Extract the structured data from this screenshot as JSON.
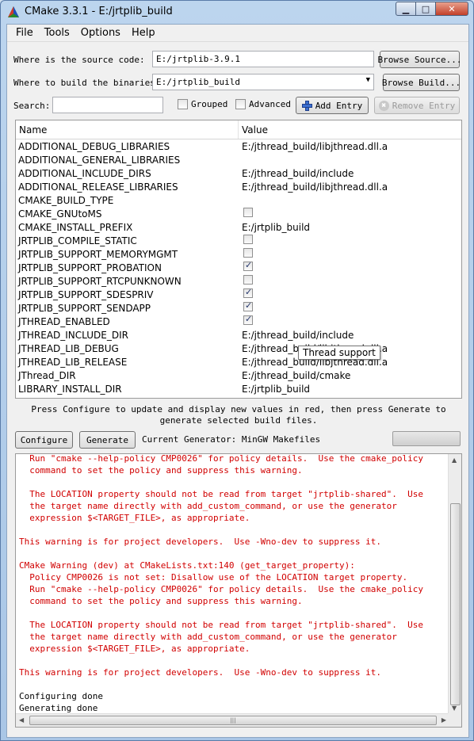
{
  "window": {
    "title": "CMake 3.3.1 - E:/jrtplib_build"
  },
  "menu": [
    "File",
    "Tools",
    "Options",
    "Help"
  ],
  "source": {
    "label": "Where is the source code:",
    "value": "E:/jrtplib-3.9.1",
    "browse": "Browse Source..."
  },
  "build": {
    "label": "Where to build the binaries:",
    "value": "E:/jrtplib_build",
    "browse": "Browse Build..."
  },
  "search": {
    "label": "Search:",
    "value": ""
  },
  "options": {
    "grouped": "Grouped",
    "advanced": "Advanced",
    "add_entry": "Add Entry",
    "remove_entry": "Remove Entry"
  },
  "table": {
    "headers": {
      "name": "Name",
      "value": "Value"
    },
    "rows": [
      {
        "name": "ADDITIONAL_DEBUG_LIBRARIES",
        "value": "E:/jthread_build/libjthread.dll.a"
      },
      {
        "name": "ADDITIONAL_GENERAL_LIBRARIES",
        "value": ""
      },
      {
        "name": "ADDITIONAL_INCLUDE_DIRS",
        "value": "E:/jthread_build/include"
      },
      {
        "name": "ADDITIONAL_RELEASE_LIBRARIES",
        "value": "E:/jthread_build/libjthread.dll.a"
      },
      {
        "name": "CMAKE_BUILD_TYPE",
        "value": ""
      },
      {
        "name": "CMAKE_GNUtoMS",
        "checked": false
      },
      {
        "name": "CMAKE_INSTALL_PREFIX",
        "value": "E:/jrtplib_build"
      },
      {
        "name": "JRTPLIB_COMPILE_STATIC",
        "checked": false
      },
      {
        "name": "JRTPLIB_SUPPORT_MEMORYMGMT",
        "checked": false
      },
      {
        "name": "JRTPLIB_SUPPORT_PROBATION",
        "checked": true
      },
      {
        "name": "JRTPLIB_SUPPORT_RTCPUNKNOWN",
        "checked": false
      },
      {
        "name": "JRTPLIB_SUPPORT_SDESPRIV",
        "checked": true
      },
      {
        "name": "JRTPLIB_SUPPORT_SENDAPP",
        "checked": true
      },
      {
        "name": "JTHREAD_ENABLED",
        "checked": true
      },
      {
        "name": "JTHREAD_INCLUDE_DIR",
        "value": "E:/jthread_build/include"
      },
      {
        "name": "JTHREAD_LIB_DEBUG",
        "value": "E:/jthread_build/libjthread.dll.a"
      },
      {
        "name": "JTHREAD_LIB_RELEASE",
        "value": "E:/jthread_build/libjthread.dll.a"
      },
      {
        "name": "JThread_DIR",
        "value": "E:/jthread_build/cmake"
      },
      {
        "name": "LIBRARY_INSTALL_DIR",
        "value": "E:/jrtplib_build"
      }
    ]
  },
  "tooltip": "Thread support",
  "hint": "Press Configure to update and display new values in red, then press Generate to generate selected build files.",
  "actions": {
    "configure": "Configure",
    "generate": "Generate",
    "generator_label": "Current Generator: MinGW Makefiles"
  },
  "log": [
    {
      "t": "  Run \"cmake --help-policy CMP0026\" for policy details.  Use the cmake_policy",
      "c": "warn"
    },
    {
      "t": "  command to set the policy and suppress this warning.",
      "c": "warn"
    },
    {
      "t": "",
      "c": "warn"
    },
    {
      "t": "  The LOCATION property should not be read from target \"jrtplib-shared\".  Use",
      "c": "warn"
    },
    {
      "t": "  the target name directly with add_custom_command, or use the generator",
      "c": "warn"
    },
    {
      "t": "  expression $<TARGET_FILE>, as appropriate.",
      "c": "warn"
    },
    {
      "t": "",
      "c": "warn"
    },
    {
      "t": "This warning is for project developers.  Use -Wno-dev to suppress it.",
      "c": "warn"
    },
    {
      "t": "",
      "c": "warn"
    },
    {
      "t": "CMake Warning (dev) at CMakeLists.txt:140 (get_target_property):",
      "c": "warn"
    },
    {
      "t": "  Policy CMP0026 is not set: Disallow use of the LOCATION target property.",
      "c": "warn"
    },
    {
      "t": "  Run \"cmake --help-policy CMP0026\" for policy details.  Use the cmake_policy",
      "c": "warn"
    },
    {
      "t": "  command to set the policy and suppress this warning.",
      "c": "warn"
    },
    {
      "t": "",
      "c": "warn"
    },
    {
      "t": "  The LOCATION property should not be read from target \"jrtplib-shared\".  Use",
      "c": "warn"
    },
    {
      "t": "  the target name directly with add_custom_command, or use the generator",
      "c": "warn"
    },
    {
      "t": "  expression $<TARGET_FILE>, as appropriate.",
      "c": "warn"
    },
    {
      "t": "",
      "c": "warn"
    },
    {
      "t": "This warning is for project developers.  Use -Wno-dev to suppress it.",
      "c": "warn"
    },
    {
      "t": "",
      "c": "info"
    },
    {
      "t": "Configuring done",
      "c": "info"
    },
    {
      "t": "Generating done",
      "c": "info"
    }
  ],
  "colors": {
    "warning_text": "#d10000",
    "window_frame": "#bcd5ee"
  }
}
